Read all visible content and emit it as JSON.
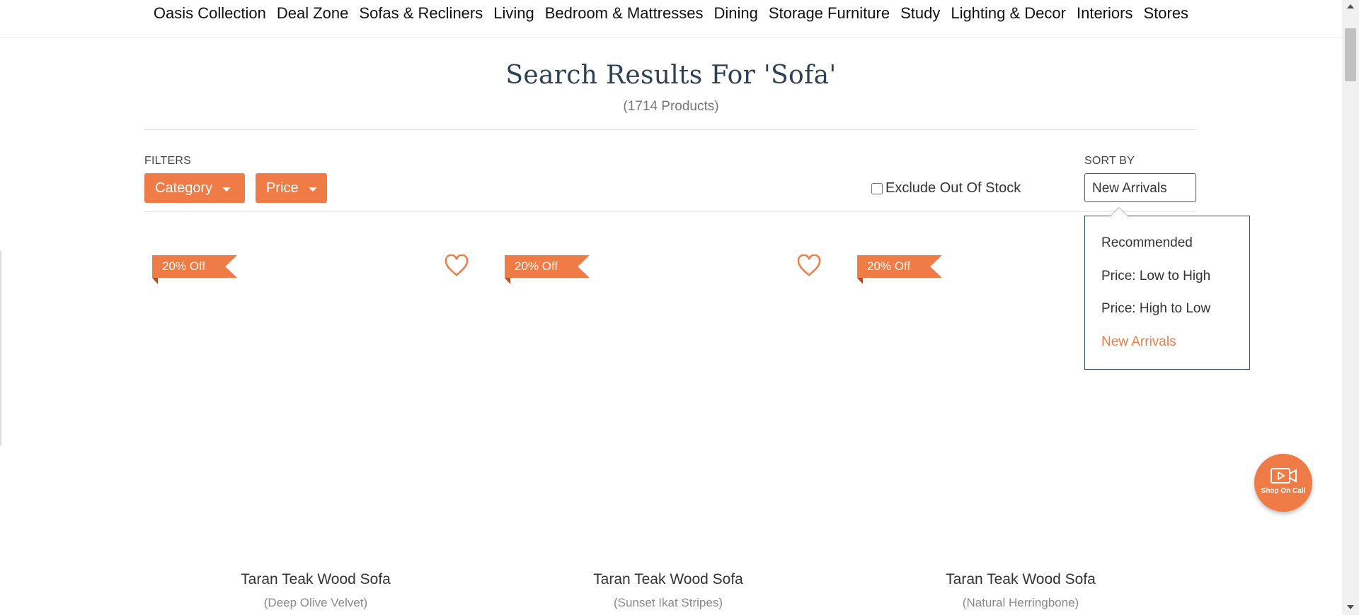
{
  "nav": {
    "items": [
      "Oasis Collection",
      "Deal Zone",
      "Sofas & Recliners",
      "Living",
      "Bedroom & Mattresses",
      "Dining",
      "Storage Furniture",
      "Study",
      "Lighting & Decor",
      "Interiors",
      "Stores"
    ]
  },
  "search": {
    "title": "Search Results For 'Sofa'",
    "count": "(1714 Products)"
  },
  "filters": {
    "label": "FILTERS",
    "category": "Category",
    "price": "Price",
    "exclude_stock": "Exclude Out Of Stock",
    "exclude_checked": false
  },
  "sort": {
    "label": "SORT BY",
    "selected": "New Arrivals",
    "options": [
      "Recommended",
      "Price: Low to High",
      "Price: High to Low",
      "New Arrivals"
    ]
  },
  "products": [
    {
      "badge": "20% Off",
      "name": "Taran Teak Wood Sofa",
      "variant": "(Deep Olive Velvet)"
    },
    {
      "badge": "20% Off",
      "name": "Taran Teak Wood Sofa",
      "variant": "(Sunset Ikat Stripes)"
    },
    {
      "badge": "20% Off",
      "name": "Taran Teak Wood Sofa",
      "variant": "(Natural Herringbone)"
    }
  ],
  "call_button": {
    "label": "Shop On Call"
  },
  "colors": {
    "accent": "#ef7b47",
    "heading": "#2c4154"
  }
}
